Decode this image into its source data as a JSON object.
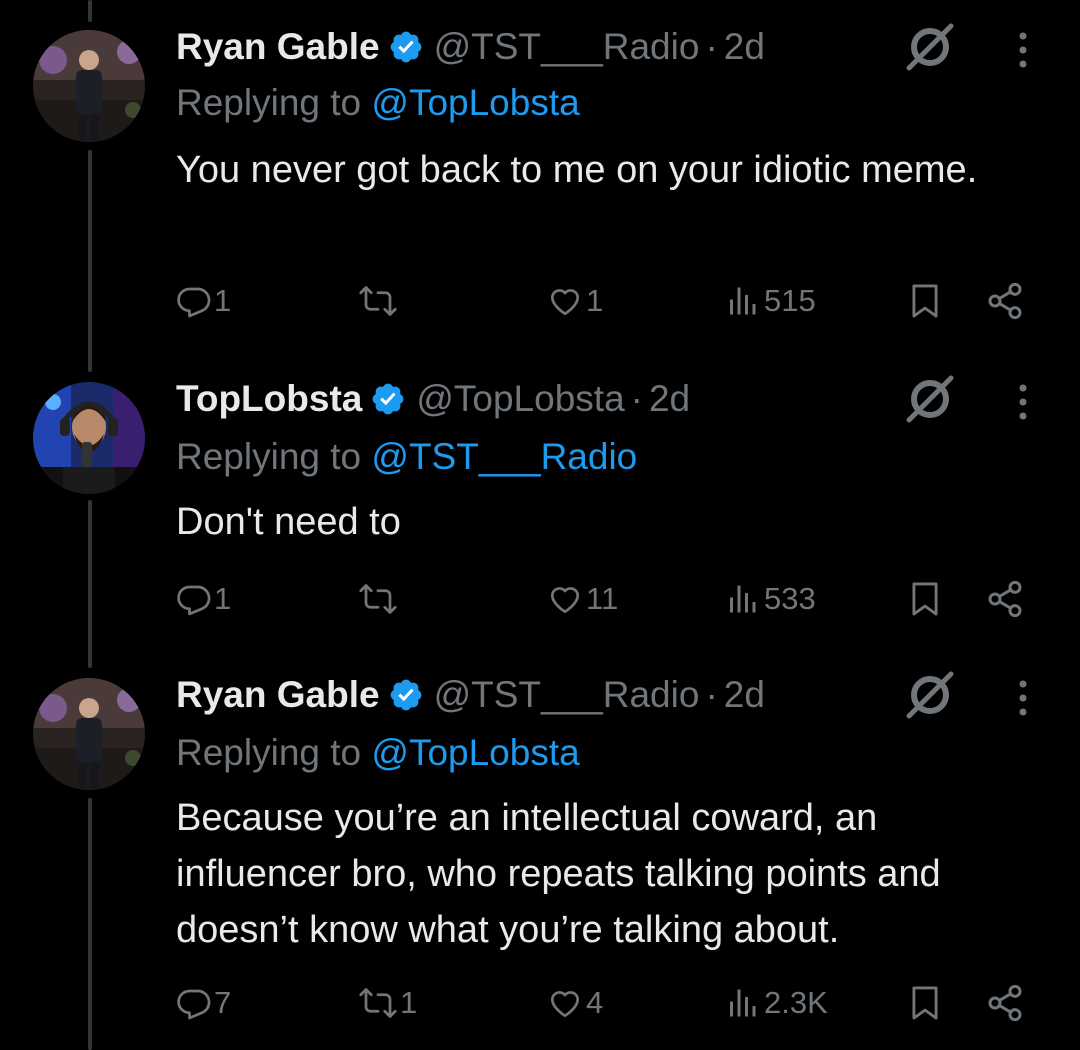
{
  "tweets": [
    {
      "name": "Ryan Gable",
      "handle": "@TST___Radio",
      "separator": "·",
      "time": "2d",
      "replying_prefix": "Replying to",
      "replying_to": "@TopLobsta",
      "text": "You never got back to me on your idiotic meme.",
      "replies": "1",
      "reposts": "",
      "likes": "1",
      "views": "515"
    },
    {
      "name": "TopLobsta",
      "handle": "@TopLobsta",
      "separator": "·",
      "time": "2d",
      "replying_prefix": "Replying to",
      "replying_to": "@TST___Radio",
      "text": "Don't need to",
      "replies": "1",
      "reposts": "",
      "likes": "11",
      "views": "533"
    },
    {
      "name": "Ryan Gable",
      "handle": "@TST___Radio",
      "separator": "·",
      "time": "2d",
      "replying_prefix": "Replying to",
      "replying_to": "@TopLobsta",
      "text": "Because you’re an intellectual coward, an influencer bro, who repeats talking points and doesn’t know what you’re talking about.",
      "replies": "7",
      "reposts": "1",
      "likes": "4",
      "views": "2.3K"
    }
  ],
  "icons": {
    "verified": "verified-badge-icon",
    "grok": "grok-icon",
    "more": "more-vertical-icon",
    "reply": "reply-icon",
    "repost": "repost-icon",
    "like": "heart-icon",
    "views": "views-icon",
    "bookmark": "bookmark-icon",
    "share": "share-icon"
  },
  "colors": {
    "background": "#000000",
    "text": "#e7e9ea",
    "secondary": "#71767b",
    "accent": "#1d9bf0",
    "thread_line": "#333639"
  }
}
